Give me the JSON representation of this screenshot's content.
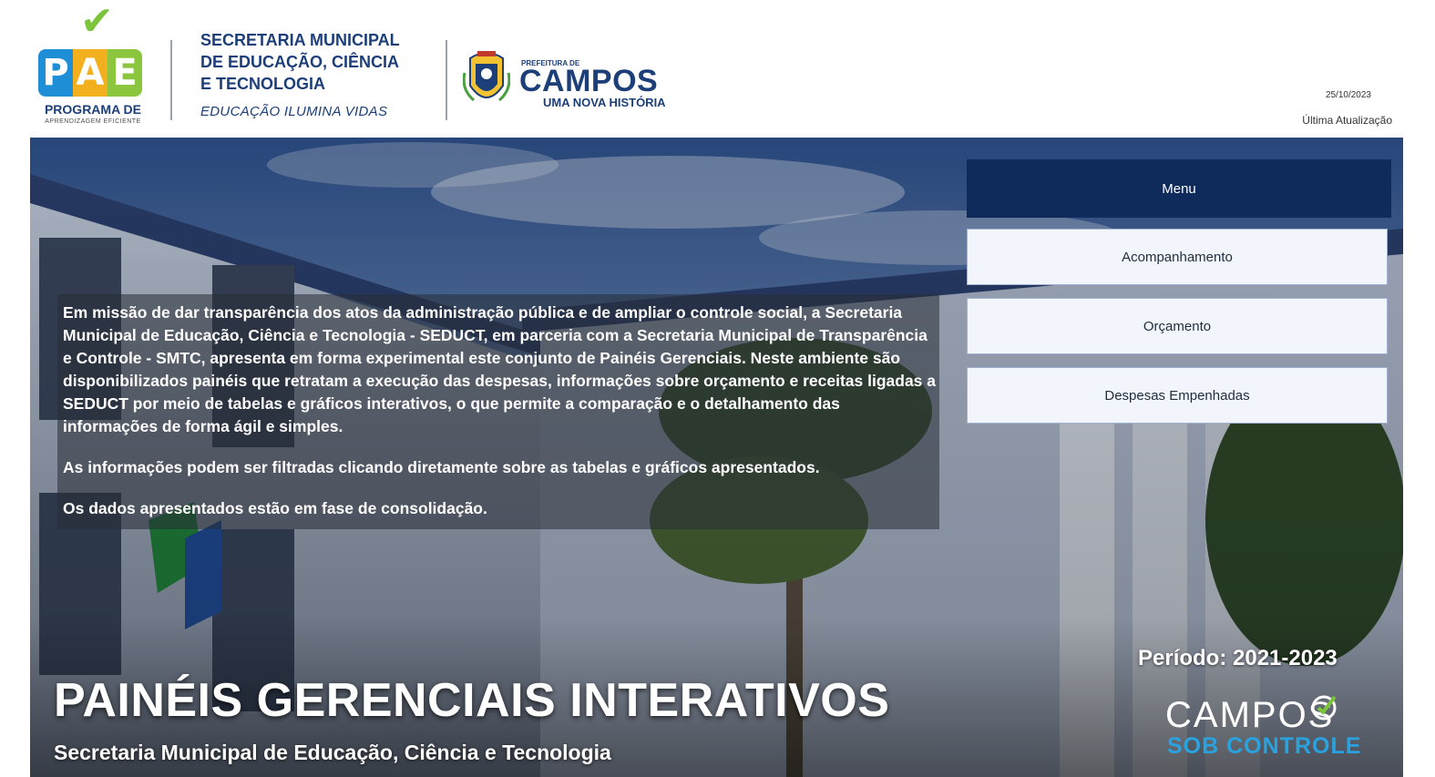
{
  "header": {
    "pae": {
      "letters": [
        "P",
        "A",
        "E"
      ],
      "programa": "PROGRAMA DE",
      "sub": "APRENDIZAGEM EFICIENTE"
    },
    "seduct": {
      "name": "SECRETARIA MUNICIPAL\nDE EDUCAÇÃO, CIÊNCIA\nE TECNOLOGIA",
      "slogan": "EDUCAÇÃO ILUMINA VIDAS"
    },
    "prefeitura": {
      "pre": "PREFEITURA DE",
      "name": "CAMPOS",
      "slogan": "UMA NOVA HISTÓRIA"
    },
    "update": {
      "date": "25/10/2023",
      "label": "Última Atualização"
    }
  },
  "intro": {
    "paragraphs": [
      "Em missão de dar transparência dos atos da administração pública e de ampliar o controle social, a Secretaria Municipal de Educação, Ciência e Tecnologia - SEDUCT, em parceria com a Secretaria Municipal de Transparência e Controle - SMTC, apresenta em forma experimental este conjunto de Painéis Gerenciais. Neste ambiente são disponibilizados painéis que retratam a execução das despesas, informações sobre orçamento e receitas ligadas a SEDUCT por meio de tabelas e gráficos interativos, o que permite a comparação e o detalhamento das informações de forma ágil e simples.",
      "As informações podem ser filtradas clicando diretamente sobre as tabelas e gráficos apresentados.",
      "Os dados apresentados estão em fase de consolidação."
    ]
  },
  "menu": {
    "title": "Menu",
    "items": [
      {
        "label": "Acompanhamento"
      },
      {
        "label": "Orçamento"
      },
      {
        "label": "Despesas Empenhadas"
      }
    ]
  },
  "hero": {
    "periodo": "Período: 2021-2023",
    "title": "PAINÉIS GERENCIAIS INTERATIVOS",
    "subtitle": "Secretaria Municipal de Educação, Ciência e Tecnologia"
  },
  "footer_logo": {
    "campos": "CAMPOS",
    "sob": "SOB CONTROLE"
  },
  "colors": {
    "brand_navy": "#0f2b5b",
    "logo_blue": "#1c3f7a",
    "pae_blue": "#1e8fd6",
    "pae_yellow": "#f2b01e",
    "pae_green": "#8cc63f",
    "menu_button_bg": "#f2f5fb",
    "sob_controle_blue": "#29a3e0"
  }
}
